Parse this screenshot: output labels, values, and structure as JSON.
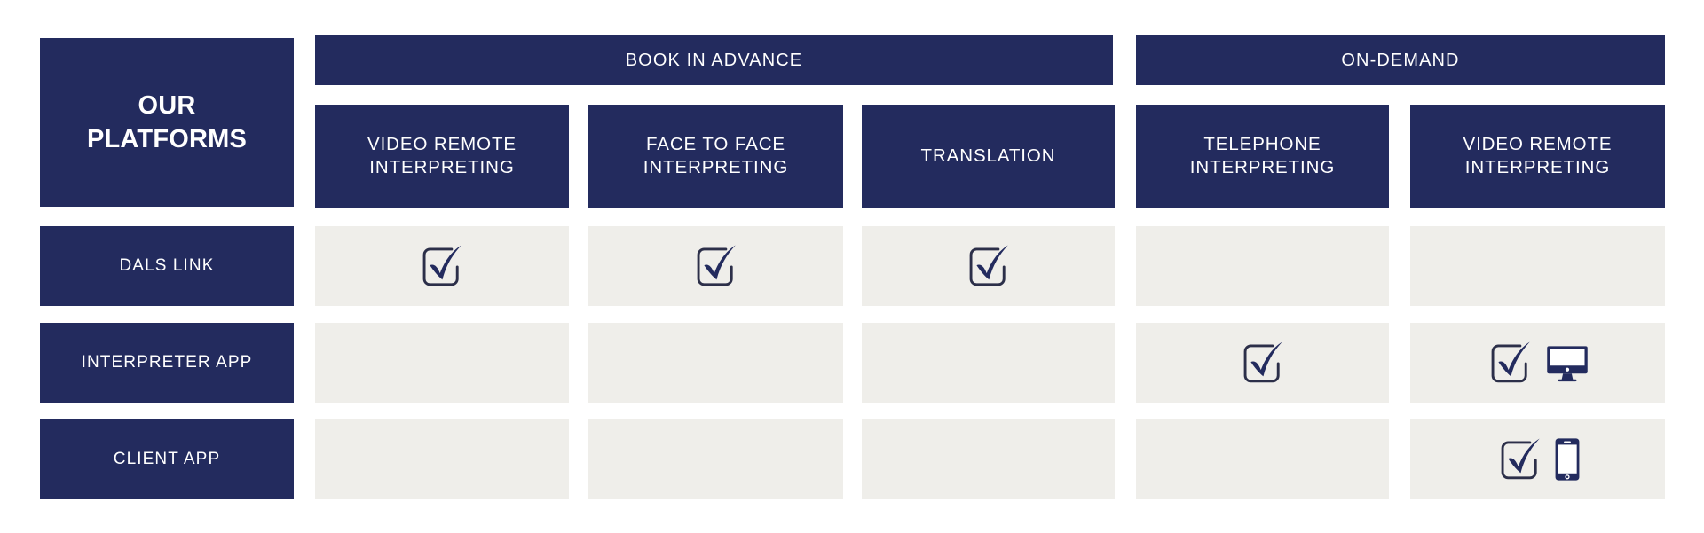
{
  "colors": {
    "navy": "#232b5e",
    "cell_background": "#efeeea",
    "page_background": "#ffffff",
    "label_text": "#ffffff"
  },
  "title": {
    "line1": "OUR",
    "line2": "PLATFORMS"
  },
  "groups": [
    {
      "id": "book-in-advance",
      "label": "BOOK IN ADVANCE",
      "span": 3
    },
    {
      "id": "on-demand",
      "label": "ON-DEMAND",
      "span": 2
    }
  ],
  "columns": [
    {
      "id": "vri-advance",
      "line1": "VIDEO REMOTE",
      "line2": "INTERPRETING",
      "group": "book-in-advance"
    },
    {
      "id": "face-to-face",
      "line1": "FACE TO FACE",
      "line2": "INTERPRETING",
      "group": "book-in-advance"
    },
    {
      "id": "translation",
      "line1": "TRANSLATION",
      "line2": "",
      "group": "book-in-advance"
    },
    {
      "id": "telephone",
      "line1": "TELEPHONE",
      "line2": "INTERPRETING",
      "group": "on-demand"
    },
    {
      "id": "vri-ondemand",
      "line1": "VIDEO REMOTE",
      "line2": "INTERPRETING",
      "group": "on-demand"
    }
  ],
  "rows": [
    {
      "id": "dals-link",
      "label": "DALS LINK",
      "cells": [
        {
          "icons": [
            "check-icon"
          ]
        },
        {
          "icons": [
            "check-icon"
          ]
        },
        {
          "icons": [
            "check-icon"
          ]
        },
        {
          "icons": []
        },
        {
          "icons": []
        }
      ]
    },
    {
      "id": "interpreter-app",
      "label": "INTERPRETER APP",
      "cells": [
        {
          "icons": []
        },
        {
          "icons": []
        },
        {
          "icons": []
        },
        {
          "icons": [
            "check-icon"
          ]
        },
        {
          "icons": [
            "check-icon",
            "desktop-monitor-icon"
          ]
        }
      ]
    },
    {
      "id": "client-app",
      "label": "CLIENT APP",
      "cells": [
        {
          "icons": []
        },
        {
          "icons": []
        },
        {
          "icons": []
        },
        {
          "icons": []
        },
        {
          "icons": [
            "check-icon",
            "smartphone-icon"
          ]
        }
      ]
    }
  ]
}
